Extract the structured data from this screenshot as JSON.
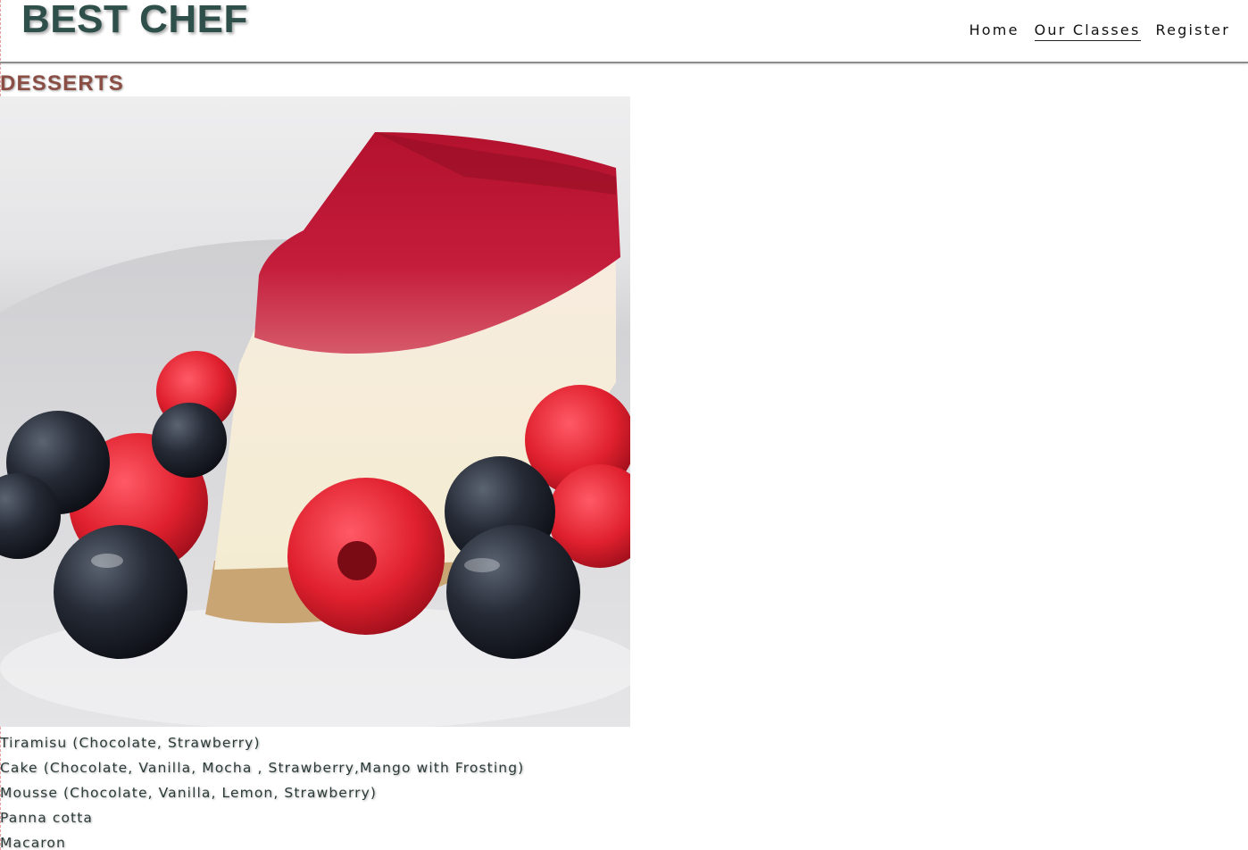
{
  "header": {
    "logo": "BEST CHEF",
    "nav": [
      {
        "label": "Home",
        "active": false
      },
      {
        "label": "Our Classes",
        "active": true
      },
      {
        "label": "Register",
        "active": false
      }
    ]
  },
  "section": {
    "title": "DESSERTS",
    "image_alt": "Slice of cheesecake with raspberry topping, raspberries and blueberries",
    "items": [
      "Tiramisu (Chocolate, Strawberry)",
      "Cake (Chocolate, Vanilla, Mocha , Strawberry,Mango with Frosting)",
      "Mousse (Chocolate, Vanilla, Lemon, Strawberry)",
      "Panna cotta",
      "Macaron"
    ]
  },
  "colors": {
    "logo": "#2e4f4a",
    "section_title": "#8a4e44",
    "list_text": "#2b3a38",
    "header_border": "#8c8c8c"
  }
}
